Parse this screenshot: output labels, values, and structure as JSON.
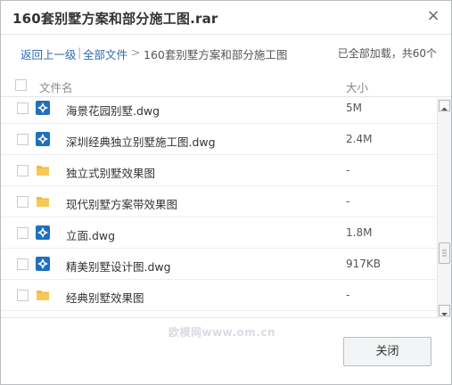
{
  "dialog": {
    "title": "160套别墅方案和部分施工图.rar",
    "close_glyph": "×"
  },
  "breadcrumb": {
    "back_label": "返回上一级",
    "separator": "|",
    "all_files_label": "全部文件",
    "arrow": ">",
    "current_folder": "160套别墅方案和部分施工图",
    "loaded_info": "已全部加载，共60个"
  },
  "list_header": {
    "name_label": "文件名",
    "size_label": "大小"
  },
  "files": [
    {
      "name": "海景花园别墅.dwg",
      "size": "5M",
      "type": "dwg"
    },
    {
      "name": "深圳经典独立别墅施工图.dwg",
      "size": "2.4M",
      "type": "dwg"
    },
    {
      "name": "独立式别墅效果图",
      "size": "-",
      "type": "folder"
    },
    {
      "name": "现代别墅方案带效果图",
      "size": "-",
      "type": "folder"
    },
    {
      "name": "立面.dwg",
      "size": "1.8M",
      "type": "dwg"
    },
    {
      "name": "精美别墅设计图.dwg",
      "size": "917KB",
      "type": "dwg"
    },
    {
      "name": "经典别墅效果图",
      "size": "-",
      "type": "folder"
    }
  ],
  "watermark": "欧模网www.om.cn",
  "footer": {
    "close_label": "关闭"
  },
  "colors": {
    "link": "#2d6bb5",
    "dwg_icon": "#1f6fbd",
    "folder_icon": "#f5b93b"
  }
}
